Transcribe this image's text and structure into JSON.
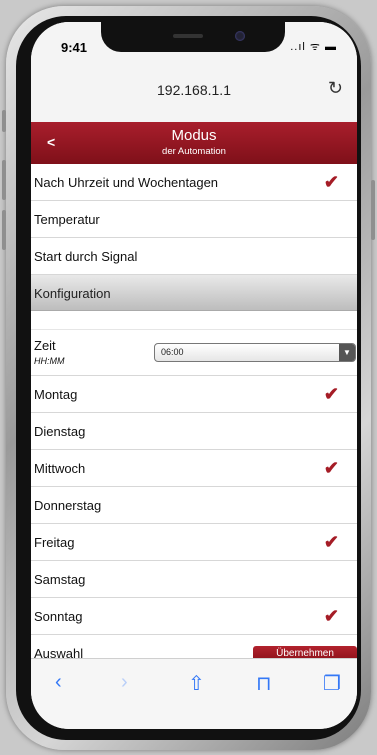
{
  "status_bar": {
    "time": "9:41",
    "icons": "..ıl ᯤ ▬"
  },
  "browser": {
    "url": "192.168.1.1"
  },
  "header": {
    "back_label": "<",
    "title": "Modus",
    "subtitle": "der Automation"
  },
  "modes": [
    {
      "label": "Nach Uhrzeit und Wochentagen",
      "checked": true
    },
    {
      "label": "Temperatur",
      "checked": false
    },
    {
      "label": "Start durch Signal",
      "checked": false
    }
  ],
  "section": {
    "label": "Konfiguration"
  },
  "zeit": {
    "label": "Zeit",
    "format": "HH:MM",
    "value": "06:00"
  },
  "days": [
    {
      "label": "Montag",
      "checked": true
    },
    {
      "label": "Dienstag",
      "checked": false
    },
    {
      "label": "Mittwoch",
      "checked": true
    },
    {
      "label": "Donnerstag",
      "checked": false
    },
    {
      "label": "Freitag",
      "checked": true
    },
    {
      "label": "Samstag",
      "checked": false
    },
    {
      "label": "Sonntag",
      "checked": true
    }
  ],
  "auswahl": {
    "label": "Auswahl",
    "button_label": "Übernehmen"
  },
  "checkmark": "✔",
  "colors": {
    "accent": "#a51c26",
    "ios_blue": "#3478f6"
  }
}
